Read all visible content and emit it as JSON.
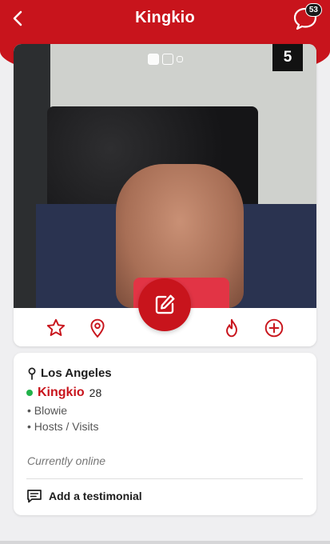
{
  "header": {
    "title": "Kingkio",
    "chat_badge": "53"
  },
  "profile_card": {
    "photo_count": "5",
    "photo_alt": "profile photo",
    "pagination": [
      "active",
      "outline",
      "small"
    ]
  },
  "info": {
    "location": "Los Angeles",
    "username": "Kingkio",
    "age": "28",
    "tags": [
      "• Blowie",
      "• Hosts / Visits"
    ],
    "status": "Currently online",
    "testimonial_label": "Add a testimonial"
  },
  "colors": {
    "brand": "#c8141c",
    "online": "#21b24a"
  },
  "icons": {
    "back": "chevron-left-icon",
    "chat": "chat-bubble-icon",
    "favorite": "star-icon",
    "map": "map-pin-icon",
    "edit": "edit-icon",
    "hot": "flame-icon",
    "add": "plus-circle-icon",
    "location": "location-pin-icon",
    "testimonial": "message-square-icon"
  }
}
